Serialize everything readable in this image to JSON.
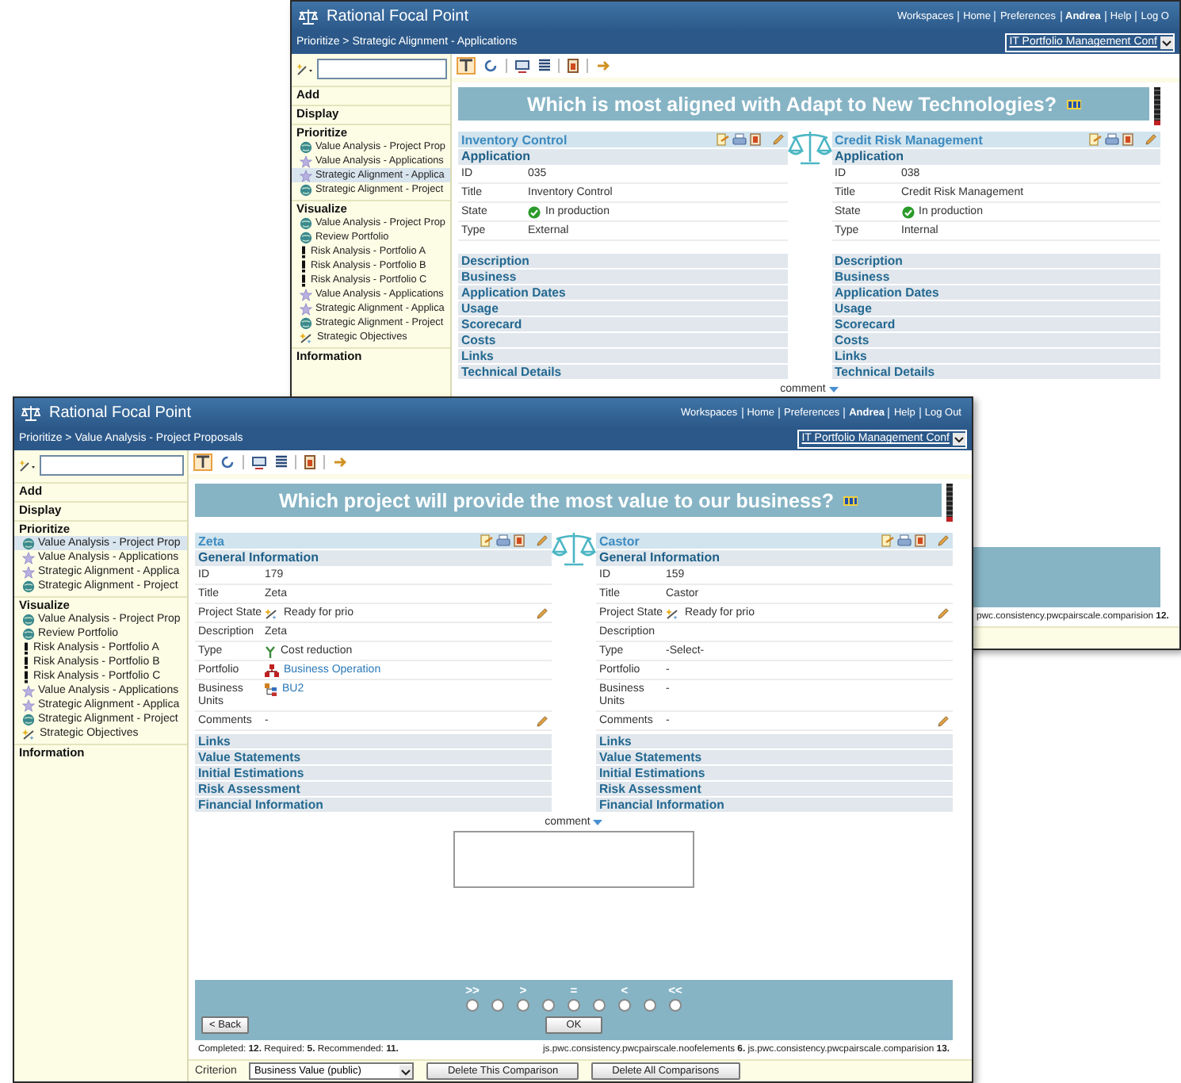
{
  "back_window": {
    "app_title": "Rational Focal Point",
    "top_links": [
      {
        "label": "Workspaces",
        "bold": false
      },
      {
        "label": "Home",
        "bold": false
      },
      {
        "label": "Preferences",
        "bold": false
      },
      {
        "label": "Andrea",
        "bold": true
      },
      {
        "label": "Help",
        "bold": false
      },
      {
        "label": "Log O",
        "bold": false
      }
    ],
    "breadcrumb": "Prioritize > Strategic Alignment - Applications",
    "config_select": "IT Portfolio Management Conf",
    "sidebar": [
      {
        "heading": "Add"
      },
      {
        "heading": "Display"
      },
      {
        "heading": "Prioritize",
        "items": [
          {
            "label": "Value Analysis - Project Prop",
            "kind": "globe",
            "selected": false
          },
          {
            "label": "Value Analysis - Applications",
            "kind": "star",
            "selected": false
          },
          {
            "label": "Strategic Alignment - Applica",
            "kind": "star",
            "selected": true
          },
          {
            "label": "Strategic Alignment - Project",
            "kind": "globe",
            "selected": false
          }
        ]
      },
      {
        "heading": "Visualize",
        "items": [
          {
            "label": "Value Analysis - Project Prop",
            "kind": "globe",
            "selected": false
          },
          {
            "label": "Review Portfolio",
            "kind": "globe",
            "selected": false
          },
          {
            "label": "Risk Analysis - Portfolio A",
            "kind": "alert",
            "selected": false
          },
          {
            "label": "Risk Analysis - Portfolio B",
            "kind": "alert",
            "selected": false
          },
          {
            "label": "Risk Analysis - Portfolio C",
            "kind": "alert",
            "selected": false
          },
          {
            "label": "Value Analysis - Applications",
            "kind": "star",
            "selected": false
          },
          {
            "label": "Strategic Alignment - Applica",
            "kind": "star",
            "selected": false
          },
          {
            "label": "Strategic Alignment - Project",
            "kind": "globe",
            "selected": false
          },
          {
            "label": "Strategic Objectives",
            "kind": "objective",
            "selected": false
          }
        ]
      },
      {
        "heading": "Information"
      }
    ],
    "question": "Which is most aligned with Adapt to New Technologies?",
    "cards": [
      {
        "title": "Inventory Control",
        "section": "Application",
        "fields": [
          {
            "label": "ID",
            "value": "035",
            "kind": "text",
            "editable": false
          },
          {
            "label": "Title",
            "value": "Inventory Control",
            "kind": "text",
            "editable": false
          },
          {
            "label": "State",
            "value": "In production",
            "kind": "state",
            "editable": false
          },
          {
            "label": "Type",
            "value": "External",
            "kind": "text",
            "editable": false
          }
        ],
        "groups": [
          "Description",
          "Business",
          "Application Dates",
          "Usage",
          "Scorecard",
          "Costs",
          "Links",
          "Technical Details"
        ]
      },
      {
        "title": "Credit Risk Management",
        "section": "Application",
        "fields": [
          {
            "label": "ID",
            "value": "038",
            "kind": "text",
            "editable": false
          },
          {
            "label": "Title",
            "value": "Credit Risk Management",
            "kind": "text",
            "editable": false
          },
          {
            "label": "State",
            "value": "In production",
            "kind": "state",
            "editable": false
          },
          {
            "label": "Type",
            "value": "Internal",
            "kind": "text",
            "editable": false
          }
        ],
        "groups": [
          "Description",
          "Business",
          "Application Dates",
          "Usage",
          "Scorecard",
          "Costs",
          "Links",
          "Technical Details"
        ]
      }
    ],
    "comment_label": "comment",
    "status": {
      "right": "pwc.consistency.pwcpairscale.comparision **12.**"
    }
  },
  "front_window": {
    "app_title": "Rational Focal Point",
    "top_links": [
      {
        "label": "Workspaces",
        "bold": false
      },
      {
        "label": "Home",
        "bold": false
      },
      {
        "label": "Preferences",
        "bold": false
      },
      {
        "label": "Andrea",
        "bold": true
      },
      {
        "label": "Help",
        "bold": false
      },
      {
        "label": "Log Out",
        "bold": false
      }
    ],
    "breadcrumb": "Prioritize > Value Analysis - Project Proposals",
    "config_select": "IT Portfolio Management Conf",
    "sidebar": [
      {
        "heading": "Add"
      },
      {
        "heading": "Display"
      },
      {
        "heading": "Prioritize",
        "items": [
          {
            "label": "Value Analysis - Project Prop",
            "kind": "globe",
            "selected": true
          },
          {
            "label": "Value Analysis - Applications",
            "kind": "star",
            "selected": false
          },
          {
            "label": "Strategic Alignment - Applica",
            "kind": "star",
            "selected": false
          },
          {
            "label": "Strategic Alignment - Project",
            "kind": "globe",
            "selected": false
          }
        ]
      },
      {
        "heading": "Visualize",
        "items": [
          {
            "label": "Value Analysis - Project Prop",
            "kind": "globe",
            "selected": false
          },
          {
            "label": "Review Portfolio",
            "kind": "globe",
            "selected": false
          },
          {
            "label": "Risk Analysis - Portfolio A",
            "kind": "alert",
            "selected": false
          },
          {
            "label": "Risk Analysis - Portfolio B",
            "kind": "alert",
            "selected": false
          },
          {
            "label": "Risk Analysis - Portfolio C",
            "kind": "alert",
            "selected": false
          },
          {
            "label": "Value Analysis - Applications",
            "kind": "star",
            "selected": false
          },
          {
            "label": "Strategic Alignment - Applica",
            "kind": "star",
            "selected": false
          },
          {
            "label": "Strategic Alignment - Project",
            "kind": "globe",
            "selected": false
          },
          {
            "label": "Strategic Objectives",
            "kind": "objective",
            "selected": false
          }
        ]
      },
      {
        "heading": "Information"
      }
    ],
    "question": "Which project will provide the most value to our business?",
    "cards": [
      {
        "title": "Zeta",
        "section": "General Information",
        "fields": [
          {
            "label": "ID",
            "value": "179",
            "kind": "text",
            "editable": false
          },
          {
            "label": "Title",
            "value": "Zeta",
            "kind": "text",
            "editable": false
          },
          {
            "label": "Project State",
            "value": "Ready for prio",
            "kind": "workflow",
            "editable": true
          },
          {
            "label": "Description",
            "value": "Zeta",
            "kind": "text",
            "editable": false
          },
          {
            "label": "Type",
            "value": "Cost reduction",
            "kind": "category",
            "editable": false
          },
          {
            "label": "Portfolio",
            "value": "Business Operation",
            "kind": "portfolio",
            "editable": false
          },
          {
            "label": "Business Units",
            "value": "BU2",
            "kind": "unit",
            "editable": false
          },
          {
            "label": "Comments",
            "value": "-",
            "kind": "text",
            "editable": true
          }
        ],
        "groups": [
          "Links",
          "Value Statements",
          "Initial Estimations",
          "Risk Assessment",
          "Financial Information"
        ]
      },
      {
        "title": "Castor",
        "section": "General Information",
        "fields": [
          {
            "label": "ID",
            "value": "159",
            "kind": "text",
            "editable": false
          },
          {
            "label": "Title",
            "value": "Castor",
            "kind": "text",
            "editable": false
          },
          {
            "label": "Project State",
            "value": "Ready for prio",
            "kind": "workflow",
            "editable": true
          },
          {
            "label": "Description",
            "kind": "text",
            "editable": false
          },
          {
            "label": "Type",
            "value": "-Select-",
            "kind": "text",
            "editable": false
          },
          {
            "label": "Portfolio",
            "value": "-",
            "kind": "text",
            "editable": false
          },
          {
            "label": "Business Units",
            "value": "-",
            "kind": "text",
            "editable": false
          },
          {
            "label": "Comments",
            "value": "-",
            "kind": "text",
            "editable": true
          }
        ],
        "groups": [
          "Links",
          "Value Statements",
          "Initial Estimations",
          "Risk Assessment",
          "Financial Information"
        ]
      }
    ],
    "comment_label": "comment",
    "scale": {
      "labels": [
        ">>",
        ">",
        "=",
        "<",
        "<<"
      ],
      "options": [
        {
          "selected": false
        },
        {
          "selected": false
        },
        {
          "selected": false
        },
        {
          "selected": false
        },
        {
          "selected": false
        },
        {
          "selected": false
        },
        {
          "selected": false
        },
        {
          "selected": false
        },
        {
          "selected": false
        }
      ]
    },
    "buttons": {
      "back": "< Back",
      "ok": "OK"
    },
    "status": {
      "left": "Completed: **12.** Required: **5.** Recommended: **11.**",
      "right": "js.pwc.consistency.pwcpairscale.noofelements **6.** js.pwc.consistency.pwcpairscale.comparision **13.**"
    },
    "footer": {
      "criterion_label": "Criterion",
      "criterion_select": "Business Value (public)",
      "buttons": [
        "Delete This Comparison",
        "Delete All Comparisons"
      ]
    }
  }
}
